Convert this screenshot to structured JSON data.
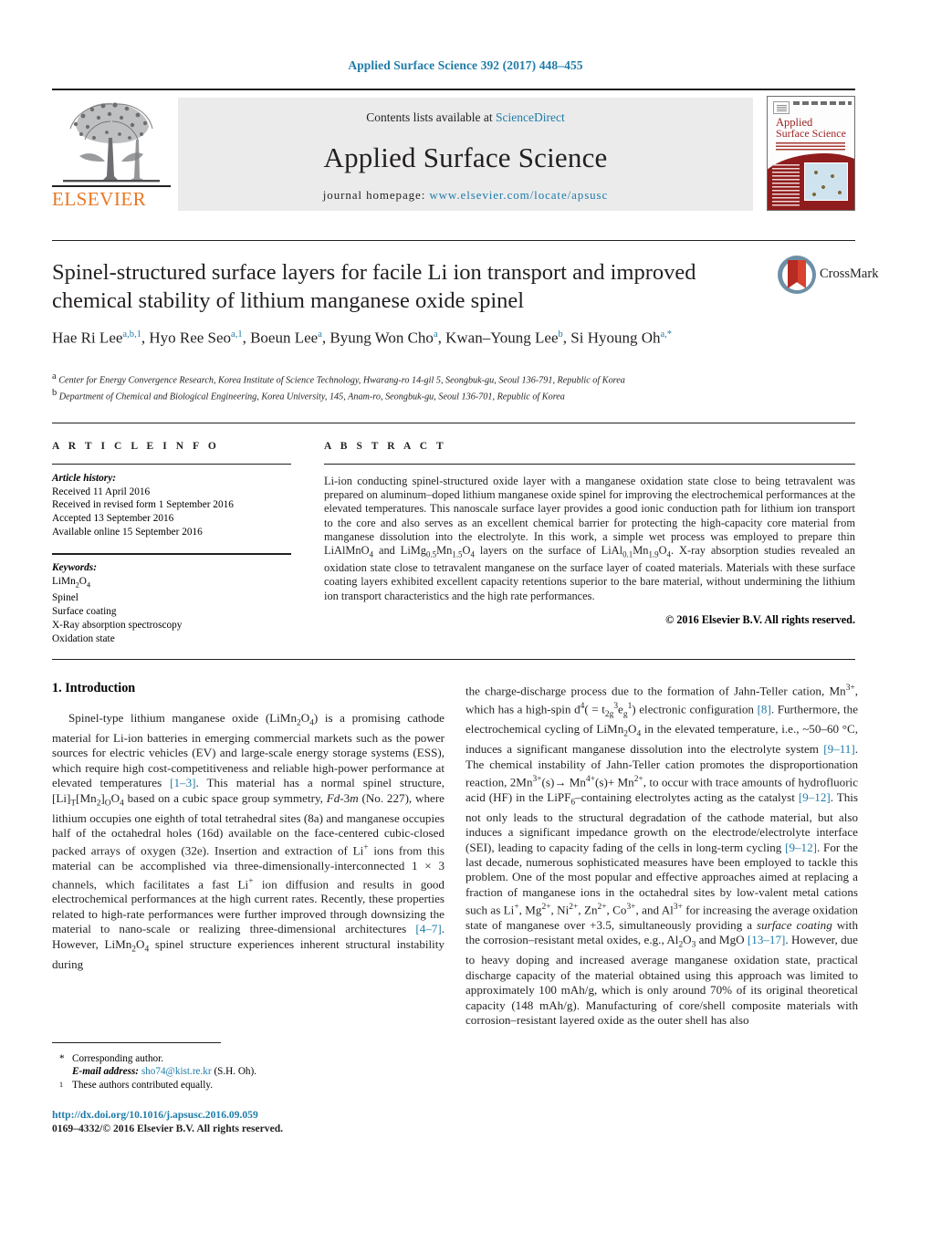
{
  "running_head": "Applied Surface Science 392 (2017) 448–455",
  "banner": {
    "publisher_name": "ELSEVIER",
    "contents_prefix": "Contents lists available at ",
    "contents_link": "ScienceDirect",
    "journal_name": "Applied Surface Science",
    "homepage_prefix": "journal homepage: ",
    "homepage_url": "www.elsevier.com/locate/apsusc",
    "cover": {
      "title_line1": "Applied",
      "title_line2": "Surface Science"
    }
  },
  "article": {
    "title": "Spinel-structured surface layers for facile Li ion transport and improved chemical stability of lithium manganese oxide spinel",
    "crossmark_label": "CrossMark",
    "authors_html": "Hae Ri Lee<sup>a,b,1</sup>, Hyo Ree Seo<sup>a,1</sup>, Boeun Lee<sup>a</sup>, Byung Won Cho<sup>a</sup>, Kwan–Young Lee<sup>b</sup>, Si Hyoung Oh<sup>a,</sup><sup>*</sup>",
    "affiliation_a": "Center for Energy Convergence Research, Korea Institute of Science Technology, Hwarang-ro 14-gil 5, Seongbuk-gu, Seoul 136-791, Republic of Korea",
    "affiliation_b": "Department of Chemical and Biological Engineering, Korea University, 145, Anam-ro, Seongbuk-gu, Seoul 136-701, Republic of Korea"
  },
  "info": {
    "heading": "A R T I C L E    I N F O",
    "history_label": "Article history:",
    "history": [
      "Received 11 April 2016",
      "Received in revised form 1 September 2016",
      "Accepted 13 September 2016",
      "Available online 15 September 2016"
    ],
    "keywords_label": "Keywords:",
    "keywords_html": [
      "LiMn<sub>2</sub>O<sub>4</sub>",
      "Spinel",
      "Surface coating",
      "X-Ray absorption spectroscopy",
      "Oxidation state"
    ]
  },
  "abstract": {
    "heading": "A B S T R A C T",
    "body_html": "Li-ion conducting spinel-structured oxide layer with a manganese oxidation state close to being tetravalent was prepared on aluminum–doped lithium manganese oxide spinel for improving the electrochemical performances at the elevated temperatures. This nanoscale surface layer provides a good ionic conduction path for lithium ion transport to the core and also serves as an excellent chemical barrier for protecting the high-capacity core material from manganese dissolution into the electrolyte. In this work, a simple wet process was employed to prepare thin LiAlMnO<sub>4</sub> and LiMg<sub>0.5</sub>Mn<sub>1.5</sub>O<sub>4</sub> layers on the surface of LiAl<sub>0.1</sub>Mn<sub>1.9</sub>O<sub>4</sub>. X-ray absorption studies revealed an oxidation state close to tetravalent manganese on the surface layer of coated materials. Materials with these surface coating layers exhibited excellent capacity retentions superior to the bare material, without undermining the lithium ion transport characteristics and the high rate performances.",
    "copyright": "© 2016 Elsevier B.V. All rights reserved."
  },
  "body": {
    "section_title": "1.  Introduction",
    "left_paragraph_html": "Spinel-type lithium manganese oxide (LiMn<sub>2</sub>O<sub>4</sub>) is a promising cathode material for Li-ion batteries in emerging commercial markets such as the power sources for electric vehicles (EV) and large-scale energy storage systems (ESS), which require high cost-competitiveness and reliable high-power performance at elevated temperatures <span class=\"ref\">[1–3]</span>. This material has a normal spinel structure, [Li]<sub>T</sub>[Mn<sub>2</sub>]<sub>O</sub>O<sub>4</sub> based on a cubic space group symmetry, <i>Fd</i>-3<i>m</i> (No. 227), where lithium occupies one eighth of total tetrahedral sites (8a) and manganese occupies half of the octahedral holes (16d) available on the face-centered cubic-closed packed arrays of oxygen (32e). Insertion and extraction of Li<sup>+</sup> ions from this material can be accomplished via three-dimensionally-interconnected 1 × 3 channels, which facilitates a fast Li<sup>+</sup> ion diffusion and results in good electrochemical performances at the high current rates. Recently, these properties related to high-rate performances were further improved through downsizing the material to nano-scale or realizing three-dimensional architectures <span class=\"ref\">[4–7]</span>. However, LiMn<sub>2</sub>O<sub>4</sub> spinel structure experiences inherent structural instability during",
    "right_paragraph_html": "the charge-discharge process due to the formation of Jahn-Teller cation, Mn<sup>3+</sup>, which has a high-spin d<sup>4</sup>( = t<sub>2g</sub><sup>3</sup>e<sub>g</sub><sup>1</sup>) electronic configuration <span class=\"ref\">[8]</span>. Furthermore, the electrochemical cycling of LiMn<sub>2</sub>O<sub>4</sub> in the elevated temperature, i.e., ~50–60 °C, induces a significant manganese dissolution into the electrolyte system <span class=\"ref\">[9–11]</span>. The chemical instability of Jahn-Teller cation promotes the disproportionation reaction, 2Mn<sup>3+</sup>(s)→ Mn<sup>4+</sup>(s)+ Mn<sup>2+</sup>, to occur with trace amounts of hydrofluoric acid (HF) in the LiPF<sub>6</sub>–containing electrolytes acting as the catalyst <span class=\"ref\">[9–12]</span>. This not only leads to the structural degradation of the cathode material, but also induces a significant impedance growth on the electrode/electrolyte interface (SEI), leading to capacity fading of the cells in long-term cycling <span class=\"ref\">[9–12]</span>. For the last decade, numerous sophisticated measures have been employed to tackle this problem. One of the most popular and effective approaches aimed at replacing a fraction of manganese ions in the octahedral sites by low-valent metal cations such as Li<sup>+</sup>, Mg<sup>2+</sup>, Ni<sup>2+</sup>, Zn<sup>2+</sup>, Co<sup>3+</sup>, and Al<sup>3+</sup> for increasing the average oxidation state of manganese over +3.5, simultaneously providing a <i>surface coating</i> with the corrosion–resistant metal oxides, e.g., Al<sub>2</sub>O<sub>3</sub> and MgO <span class=\"ref\">[13–17]</span>. However, due to heavy doping and increased average manganese oxidation state, practical discharge capacity of the material obtained using this approach was limited to approximately 100 mAh/g, which is only around 70% of its original theoretical capacity (148 mAh/g). Manufacturing of core/shell composite materials with corrosion–resistant layered oxide as the outer shell has also"
  },
  "footnotes": {
    "corresponding_marker": "*",
    "corresponding_text": "Corresponding author.",
    "email_label": "E-mail address:",
    "email": "sho74@kist.re.kr",
    "email_suffix": "(S.H. Oh).",
    "equal_marker": "1",
    "equal_text": "These authors contributed equally."
  },
  "footer": {
    "doi": "http://dx.doi.org/10.1016/j.apsusc.2016.09.059",
    "issn": "0169–4332/© 2016 Elsevier B.V. All rights reserved."
  },
  "colors": {
    "link": "#1f7ba8",
    "elsevier_orange": "#e87722",
    "cover_red": "#8f1d1d"
  }
}
